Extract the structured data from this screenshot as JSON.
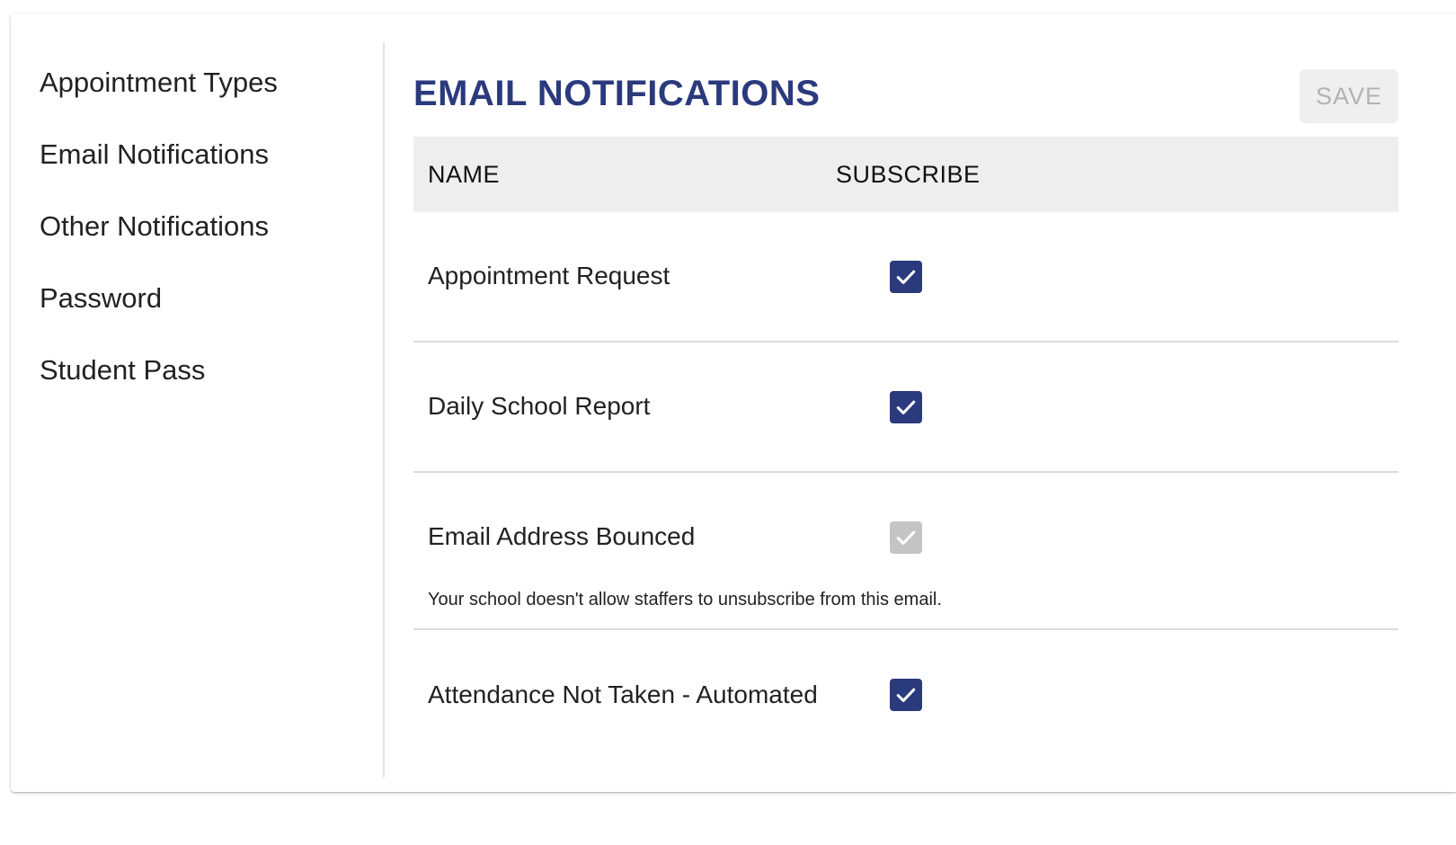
{
  "sidebar": {
    "items": [
      {
        "label": "Appointment Types"
      },
      {
        "label": "Email Notifications"
      },
      {
        "label": "Other Notifications"
      },
      {
        "label": "Password"
      },
      {
        "label": "Student Pass"
      }
    ]
  },
  "main": {
    "title": "EMAIL NOTIFICATIONS",
    "save_label": "SAVE",
    "table": {
      "headers": {
        "name": "NAME",
        "subscribe": "SUBSCRIBE"
      },
      "rows": [
        {
          "name": "Appointment Request",
          "subscribed": true,
          "disabled": false
        },
        {
          "name": "Daily School Report",
          "subscribed": true,
          "disabled": false
        },
        {
          "name": "Email Address Bounced",
          "subscribed": true,
          "disabled": true,
          "note": "Your school doesn't allow staffers to unsubscribe from this email."
        },
        {
          "name": "Attendance Not Taken - Automated",
          "subscribed": true,
          "disabled": false
        }
      ]
    }
  },
  "colors": {
    "accent": "#2b3a7d",
    "disabled_check": "#c4c4c4",
    "header_bg": "#eeeeee"
  },
  "icons": {
    "checkbox": "check-icon"
  }
}
